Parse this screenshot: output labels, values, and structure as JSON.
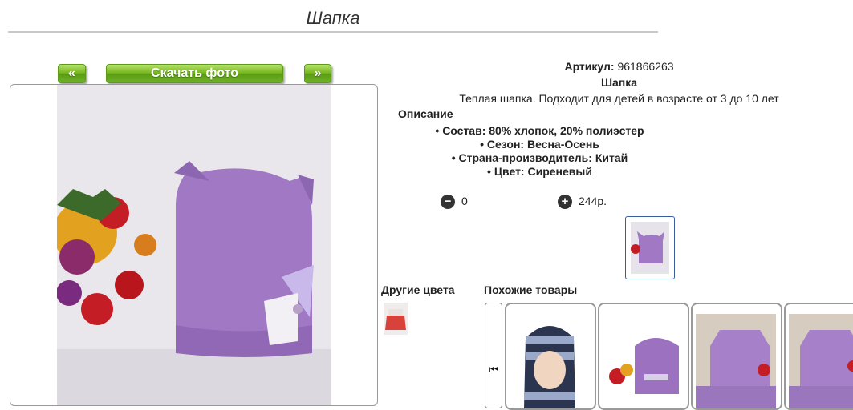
{
  "page": {
    "title": "Шапка"
  },
  "photo_nav": {
    "prev_label": "«",
    "download_label": "Скачать фото",
    "next_label": "»"
  },
  "product": {
    "article_label": "Артикул:",
    "article_value": "961866263",
    "name": "Шапка",
    "short_description": "Теплая шапка. Подходит для детей в возрасте от 3 до 10 лет",
    "description_heading": "Описание",
    "attributes": [
      "Состав: 80% хлопок, 20% полиэстер",
      "Сезон: Весна-Осень",
      "Страна-производитель: Китай",
      "Цвет: Сиреневый"
    ],
    "quantity": "0",
    "price": "244р.",
    "colors": {
      "accent_green": "#74b51c",
      "hat_lilac": "#a078c4",
      "thumb_border": "#3a5da0"
    }
  },
  "sections": {
    "other_colors": "Другие цвета",
    "similar_products": "Похожие товары"
  },
  "icons": {
    "minus": "minus-circle-icon",
    "plus": "plus-circle-icon",
    "carousel_prev": "skip-previous-icon"
  }
}
